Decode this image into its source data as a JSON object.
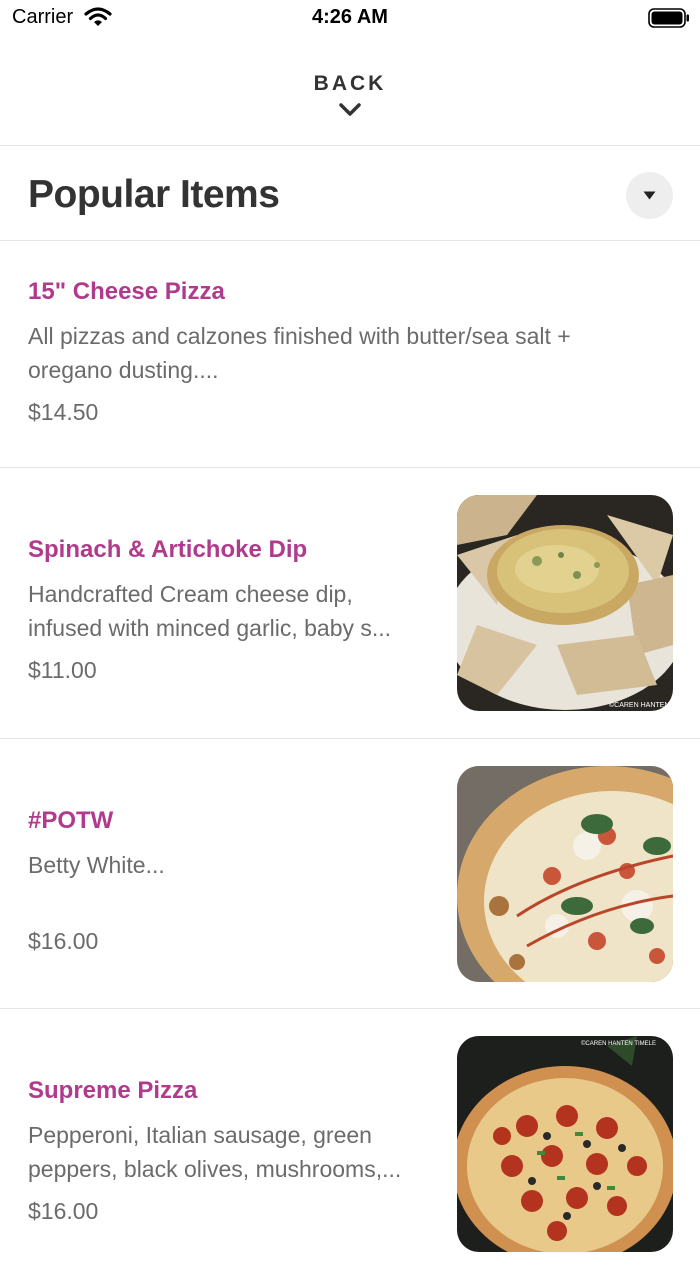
{
  "status_bar": {
    "carrier": "Carrier",
    "time": "4:26 AM"
  },
  "nav": {
    "back_label": "BACK"
  },
  "section": {
    "title": "Popular Items"
  },
  "items": [
    {
      "name": "15\" Cheese Pizza",
      "description": "All pizzas and calzones finished with butter/sea salt + oregano dusting....",
      "price": "$14.50"
    },
    {
      "name": "Spinach & Artichoke Dip",
      "description_line1": "Handcrafted Cream cheese dip,",
      "description_line2": "infused with minced garlic, baby s...",
      "price": "$11.00",
      "image_caption": "©CAREN HANTEN"
    },
    {
      "name": "#POTW",
      "description": "Betty White...",
      "price": "$16.00"
    },
    {
      "name": "Supreme Pizza",
      "description_line1": "Pepperoni, Italian sausage, green",
      "description_line2": "peppers, black olives, mushrooms,...",
      "price": "$16.00",
      "image_caption": "©CAREN HANTEN TIMELE"
    }
  ],
  "colors": {
    "accent": "#b03a8c",
    "text_dark": "#333333",
    "text_muted": "#6b6b6b",
    "divider": "#e6e6e6"
  }
}
